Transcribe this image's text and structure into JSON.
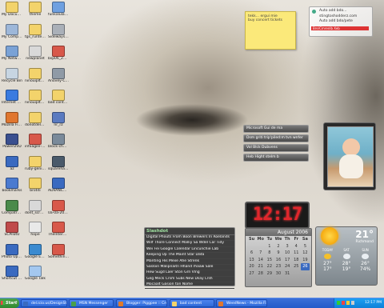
{
  "desktop_icons": [
    {
      "label": "My Documents",
      "color": "#f3d36b"
    },
    {
      "label": "theme",
      "color": "#f3d36b"
    },
    {
      "label": "funkalulator",
      "color": "#6fa0e0"
    },
    {
      "label": "My Computer",
      "color": "#9db7d9"
    },
    {
      "label": "tgs_runtes...",
      "color": "#f3d36b"
    },
    {
      "label": "Sideways.D...",
      "color": "#aab0b8"
    },
    {
      "label": "My Network Places",
      "color": "#7aa2d6"
    },
    {
      "label": "newplanet",
      "color": "#d9d9d9"
    },
    {
      "label": "bsp06_20...",
      "color": "#d8584a"
    },
    {
      "label": "Recycle Bin",
      "color": "#c7d5e2"
    },
    {
      "label": "ninouiplts=...",
      "color": "#f3d36b"
    },
    {
      "label": "Anovey-C5...",
      "color": "#8f9aa6"
    },
    {
      "label": "Internet Explorer",
      "color": "#3a7be0"
    },
    {
      "label": "ninouiplts=...",
      "color": "#f3d36b"
    },
    {
      "label": "bad content",
      "color": "#f3d36b"
    },
    {
      "label": "Mozilla Firefox",
      "color": "#e0762e"
    },
    {
      "label": "donotdelp...",
      "color": "#f3d36b"
    },
    {
      "label": "nr_rz",
      "color": "#5a7ac0"
    },
    {
      "label": "PowerDVD",
      "color": "#3a4f8f"
    },
    {
      "label": "infoagile-1...",
      "color": "#d8584a"
    },
    {
      "label": "block-ched...",
      "color": "#7a8a9a"
    },
    {
      "label": "az",
      "color": "#3a6ac0"
    },
    {
      "label": "ruby-genist...",
      "color": "#f3d36b"
    },
    {
      "label": "squarehalf...",
      "color": "#4a5a6a"
    },
    {
      "label": "bookmarks",
      "color": "#4a7ad0"
    },
    {
      "label": "brotiti",
      "color": "#f3d36b"
    },
    {
      "label": "ADVANCED...",
      "color": "#3a6ac0"
    },
    {
      "label": "Compatruns...",
      "color": "#4a8a4a"
    },
    {
      "label": "dont_scrape...",
      "color": "#d9d9d9"
    },
    {
      "label": "0a-0a-2006...",
      "color": "#d8584a"
    },
    {
      "label": "SCPilotU",
      "color": "#c04a4a"
    },
    {
      "label": "hope",
      "color": "#e9e9e9"
    },
    {
      "label": "Thelnternet...",
      "color": "#d8584a"
    },
    {
      "label": "Photo Upload",
      "color": "#3a6ac0"
    },
    {
      "label": "Google Earth",
      "color": "#3a8ad0"
    },
    {
      "label": "Something...",
      "color": "#d8584a"
    },
    {
      "label": "Shortcut to processing",
      "color": "#3a6ac0"
    },
    {
      "label": "Google Talk",
      "color": "#a4c8f0"
    }
  ],
  "sticky_note": {
    "lines": [
      "tekk... ergui mie",
      "buy concert tickets"
    ]
  },
  "feed_headlines": {
    "title": "Auto add bdo...",
    "items": [
      "stingtoshodderz.com",
      "Auto add bdo/pete"
    ],
    "bar_label": "Bre/Cmrenlb Xeb"
  },
  "gadget_list": [
    "Microsoft Gui de ma",
    "Dsm griti trip'piled:m tvn wnfer",
    "Vol Blck Dubvens",
    "Heb Hight stelm b"
  ],
  "slashdot": {
    "title": "Slashdot",
    "items": [
      "Digital Phouts From Boon Brewers In Roelands",
      "Wilf Thore Connect Malliy Sa Wdel Car Tidy",
      "Wei Fei Google Calendar Lincunchie Lab",
      "Keeping Up The Maint Star Data",
      "Manting His Mexe Ahe Strenk",
      "Sasloin Malipnaitn Hhand rhaaw Sale",
      "Hew Sugd Laer Ston Grn Vlng",
      "Geg Meck Crsm Subs New Dsay Lrsh",
      "Mocaalt Gasion ton Nome"
    ]
  },
  "clock": {
    "time": "12:17"
  },
  "calendar": {
    "month": "August 2006",
    "weekdays": [
      "Su",
      "Mo",
      "Tu",
      "We",
      "Th",
      "Fr",
      "Sa"
    ],
    "days": [
      "",
      "",
      "1",
      "2",
      "3",
      "4",
      "5",
      "6",
      "7",
      "8",
      "9",
      "10",
      "11",
      "12",
      "13",
      "14",
      "15",
      "16",
      "17",
      "18",
      "19",
      "20",
      "21",
      "22",
      "23",
      "24",
      "25",
      "26",
      "27",
      "28",
      "29",
      "30",
      "31",
      "",
      ""
    ],
    "today": "26"
  },
  "weather": {
    "temp": "21°",
    "city": "Richmond",
    "days": [
      "TODAY",
      "SAT",
      "SUN"
    ],
    "highs": [
      "27°",
      "28°",
      "26°"
    ],
    "lows": [
      "17°",
      "19°",
      "74%"
    ]
  },
  "taskbar": {
    "start_label": "Start",
    "buttons": [
      {
        "label": "del.icio.us/DesignStampC...",
        "color": "#3a6ac0"
      },
      {
        "label": "MSN Messenger",
        "color": "#4aa04a"
      },
      {
        "label": "Blogger: Piggpee :: Cre...",
        "color": "#e07a2a"
      },
      {
        "label": "bad content",
        "color": "#f3d36b"
      },
      {
        "label": "WeedNews - Mozilla Fire...",
        "color": "#e0762e"
      }
    ],
    "time": "12:17 PM"
  }
}
